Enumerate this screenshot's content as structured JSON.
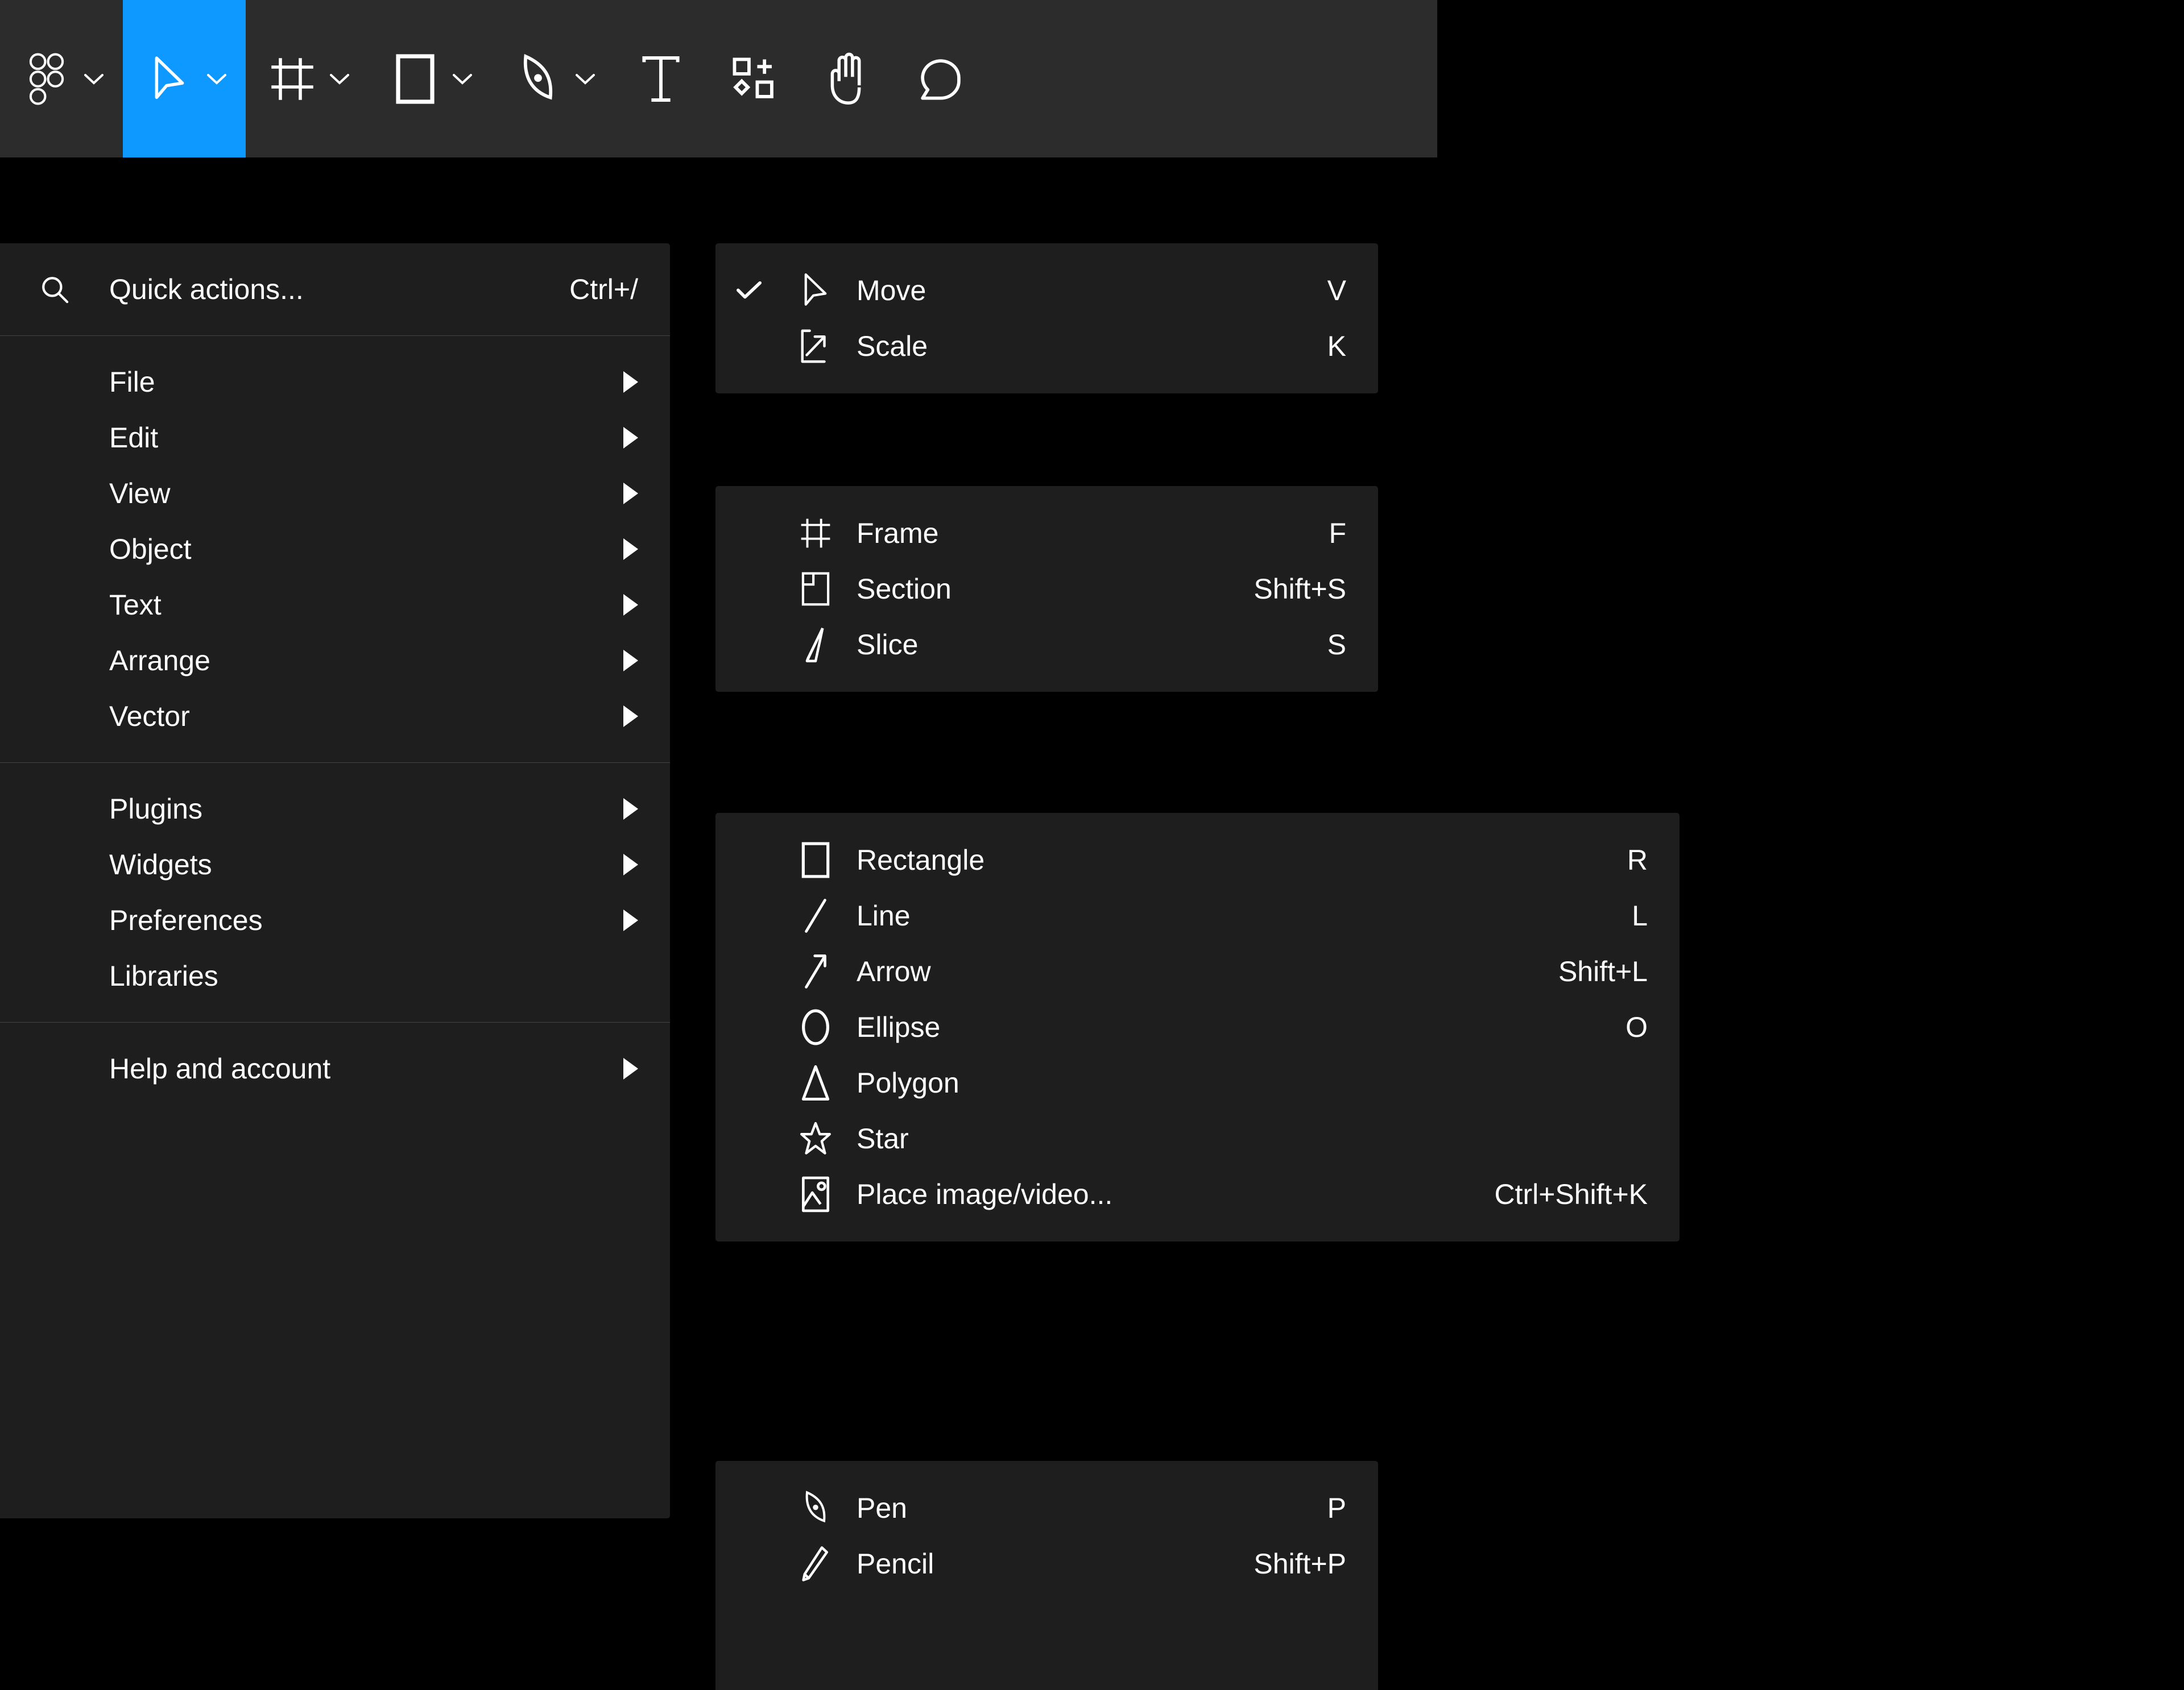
{
  "app": {
    "name": "Figma",
    "theme_bg": "#000000",
    "panel_bg": "#1e1e1e",
    "toolbar_bg": "#2c2c2c",
    "accent": "#0d99ff"
  },
  "toolbar": {
    "items": [
      {
        "id": "figma-menu",
        "icon": "figma-logo-icon",
        "caret": true,
        "active": false
      },
      {
        "id": "move-tool",
        "icon": "cursor-arrow-icon",
        "caret": true,
        "active": true
      },
      {
        "id": "frame-tool",
        "icon": "frame-icon",
        "caret": true,
        "active": false
      },
      {
        "id": "shape-tool",
        "icon": "rectangle-icon",
        "caret": true,
        "active": false
      },
      {
        "id": "pen-tool",
        "icon": "pen-icon",
        "caret": true,
        "active": false
      },
      {
        "id": "text-tool",
        "icon": "text-icon",
        "caret": false,
        "active": false
      },
      {
        "id": "resources-tool",
        "icon": "components-plus-icon",
        "caret": false,
        "active": false
      },
      {
        "id": "hand-tool",
        "icon": "hand-icon",
        "caret": false,
        "active": false
      },
      {
        "id": "comment-tool",
        "icon": "comment-bubble-icon",
        "caret": false,
        "active": false
      }
    ]
  },
  "main_menu": {
    "quick_actions": {
      "icon": "search-icon",
      "label": "Quick actions...",
      "shortcut": "Ctrl+/"
    },
    "groups": [
      {
        "items": [
          {
            "label": "File",
            "submenu": true
          },
          {
            "label": "Edit",
            "submenu": true
          },
          {
            "label": "View",
            "submenu": true
          },
          {
            "label": "Object",
            "submenu": true
          },
          {
            "label": "Text",
            "submenu": true
          },
          {
            "label": "Arrange",
            "submenu": true
          },
          {
            "label": "Vector",
            "submenu": true
          }
        ]
      },
      {
        "items": [
          {
            "label": "Plugins",
            "submenu": true
          },
          {
            "label": "Widgets",
            "submenu": true
          },
          {
            "label": "Preferences",
            "submenu": true
          },
          {
            "label": "Libraries",
            "submenu": false
          }
        ]
      },
      {
        "items": [
          {
            "label": "Help and account",
            "submenu": true
          }
        ]
      }
    ]
  },
  "flyouts": [
    {
      "id": "move-group",
      "items": [
        {
          "label": "Move",
          "shortcut": "V",
          "icon": "cursor-arrow-icon",
          "checked": true
        },
        {
          "label": "Scale",
          "shortcut": "K",
          "icon": "scale-corner-icon",
          "checked": false
        }
      ]
    },
    {
      "id": "frame-group",
      "items": [
        {
          "label": "Frame",
          "shortcut": "F",
          "icon": "frame-icon",
          "checked": false
        },
        {
          "label": "Section",
          "shortcut": "Shift+S",
          "icon": "section-icon",
          "checked": false
        },
        {
          "label": "Slice",
          "shortcut": "S",
          "icon": "slice-icon",
          "checked": false
        }
      ]
    },
    {
      "id": "shape-group",
      "items": [
        {
          "label": "Rectangle",
          "shortcut": "R",
          "icon": "rectangle-icon",
          "checked": false
        },
        {
          "label": "Line",
          "shortcut": "L",
          "icon": "line-icon",
          "checked": false
        },
        {
          "label": "Arrow",
          "shortcut": "Shift+L",
          "icon": "arrow-icon",
          "checked": false
        },
        {
          "label": "Ellipse",
          "shortcut": "O",
          "icon": "ellipse-icon",
          "checked": false
        },
        {
          "label": "Polygon",
          "shortcut": "",
          "icon": "polygon-icon",
          "checked": false
        },
        {
          "label": "Star",
          "shortcut": "",
          "icon": "star-icon",
          "checked": false
        },
        {
          "label": "Place image/video...",
          "shortcut": "Ctrl+Shift+K",
          "icon": "image-icon",
          "checked": false
        }
      ]
    },
    {
      "id": "pen-group",
      "items": [
        {
          "label": "Pen",
          "shortcut": "P",
          "icon": "pen-icon",
          "checked": false
        },
        {
          "label": "Pencil",
          "shortcut": "Shift+P",
          "icon": "pencil-icon",
          "checked": false
        }
      ]
    }
  ]
}
